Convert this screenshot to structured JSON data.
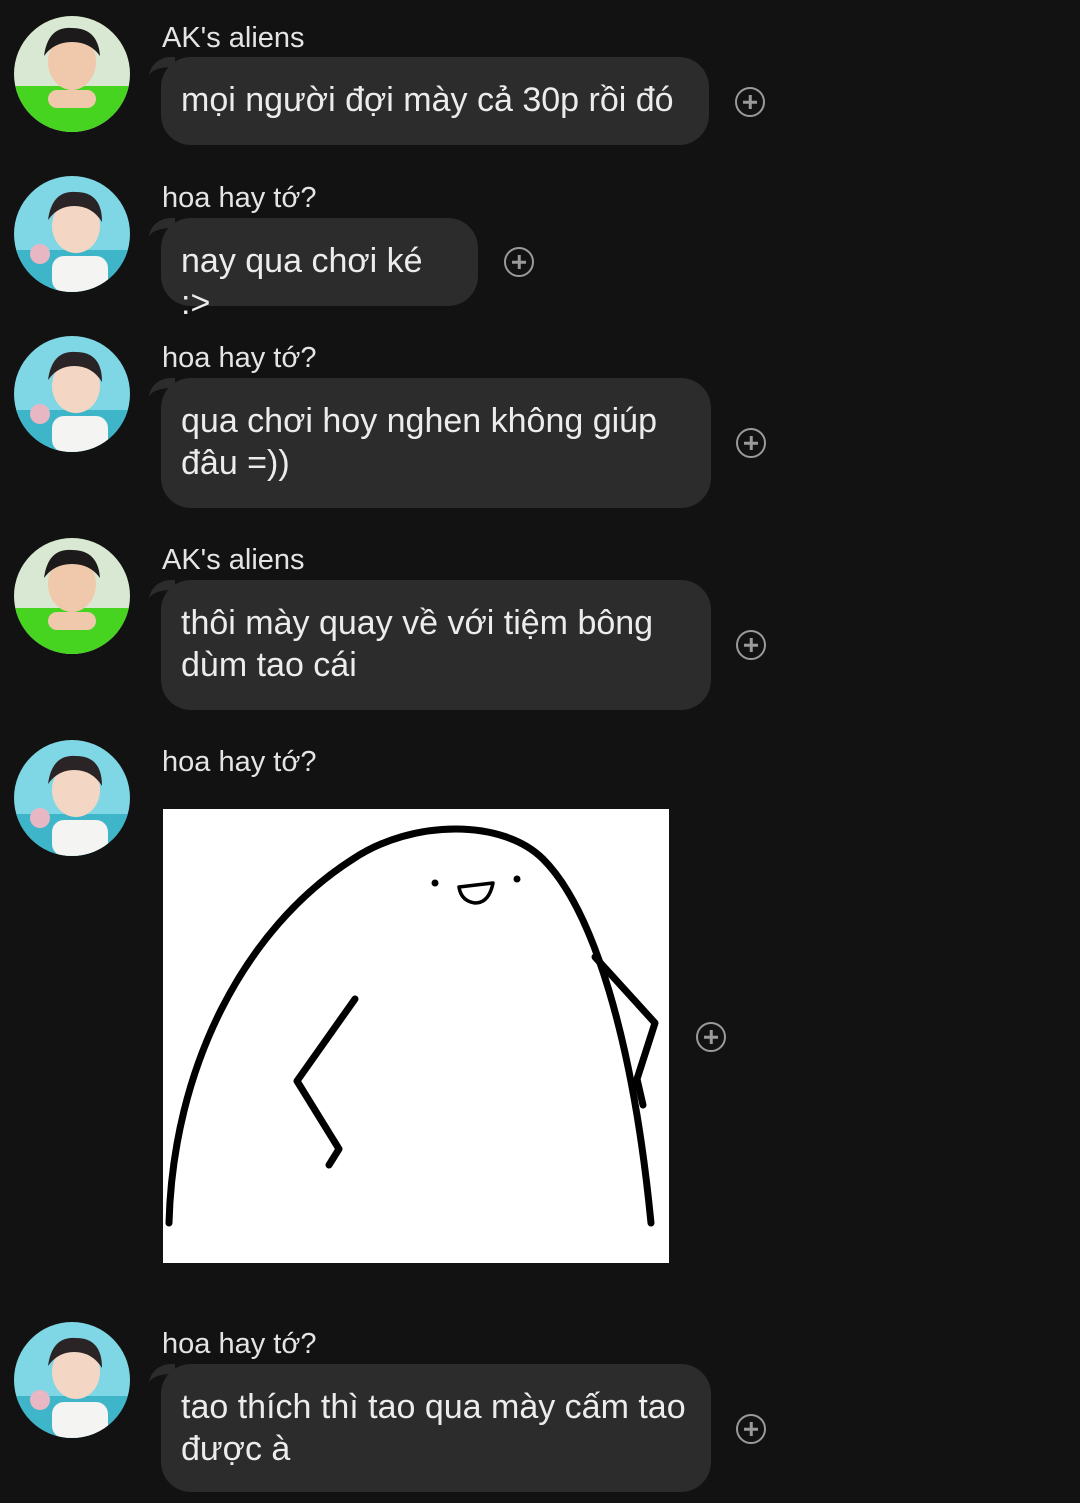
{
  "messages": [
    {
      "sender": "AK's aliens",
      "avatar": "avatar-green-shirt",
      "text": "mọi người đợi mày cả 30p rồi đó"
    },
    {
      "sender": "hoa hay tớ?",
      "avatar": "avatar-pool",
      "text": "nay qua chơi ké :>"
    },
    {
      "sender": "hoa hay tớ?",
      "avatar": "avatar-pool",
      "text": "qua chơi hoy nghen không giúp đâu =))"
    },
    {
      "sender": "AK's aliens",
      "avatar": "avatar-green-shirt",
      "text": "thôi mày quay về với tiệm bông dùm tao cái"
    },
    {
      "sender": "hoa hay tớ?",
      "avatar": "avatar-pool",
      "sticker": "blob-sticker"
    },
    {
      "sender": "hoa hay tớ?",
      "avatar": "avatar-pool",
      "text": "tao thích thì tao qua mày cấm tao được à"
    }
  ],
  "colors": {
    "background": "#121212",
    "bubble": "#2c2c2d",
    "text": "#ececec",
    "icon": "#9a9a9a"
  }
}
